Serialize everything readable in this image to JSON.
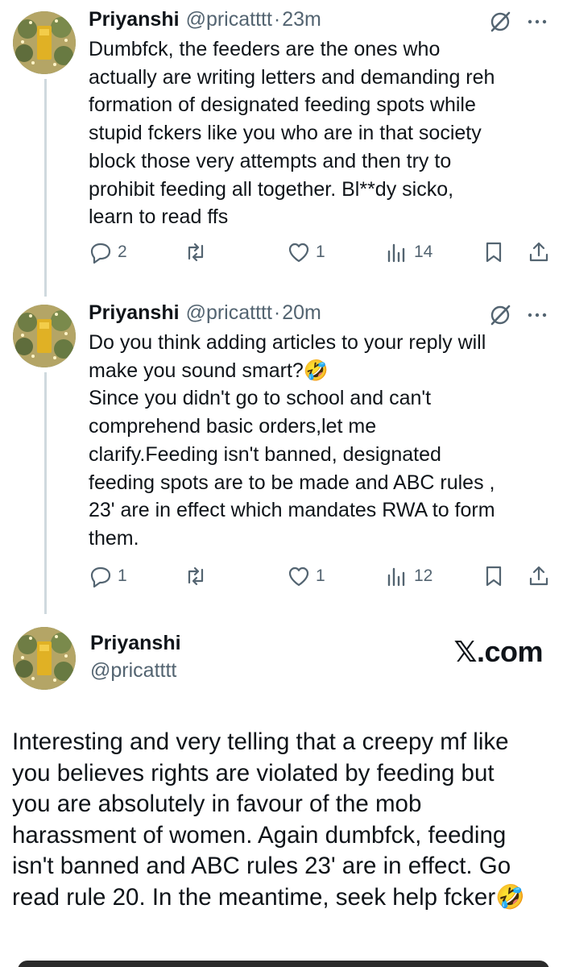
{
  "tweets": [
    {
      "name": "Priyanshi",
      "handle": "@pricatttt",
      "separator": "·",
      "time": "23m",
      "text": "Dumbfck, the feeders are the ones who\nactually are writing letters and demanding reh\nformation of designated feeding spots while\nstupid fckers like you who are in that society\nblock those very attempts and then try to\nprohibit feeding all together. Bl**dy sicko,\nlearn to read ffs",
      "replies": "2",
      "likes": "1",
      "views": "14"
    },
    {
      "name": "Priyanshi",
      "handle": "@pricatttt",
      "separator": "·",
      "time": "20m",
      "text": "Do you think adding articles to your reply will\nmake you sound smart?🤣\nSince you didn't go to school and can't\ncomprehend basic orders,let me\nclarify.Feeding isn't banned, designated\nfeeding spots are to be made and ABC rules ,\n23' are in effect which mandates RWA to form\nthem.",
      "replies": "1",
      "likes": "1",
      "views": "12"
    }
  ],
  "quote": {
    "name": "Priyanshi",
    "handle": "@pricatttt",
    "watermark": "𝕏.com",
    "text": "Interesting and very telling that a creepy mf like\nyou believes rights are violated by feeding but\nyou are absolutely in favour of the mob\nharassment of women. Again dumbfck, feeding\nisn't banned and ABC rules 23' are in effect. Go\nread rule 20. In the meantime, seek help fcker🤣"
  },
  "icons": {
    "reply": "reply-icon",
    "repost": "repost-icon",
    "like": "heart-icon",
    "views": "views-icon",
    "bookmark": "bookmark-icon",
    "share": "share-icon",
    "grok": "grok-icon",
    "more": "more-icon"
  },
  "colors": {
    "text": "#0f1419",
    "secondary": "#536471",
    "thread_line": "#cfd9de"
  }
}
